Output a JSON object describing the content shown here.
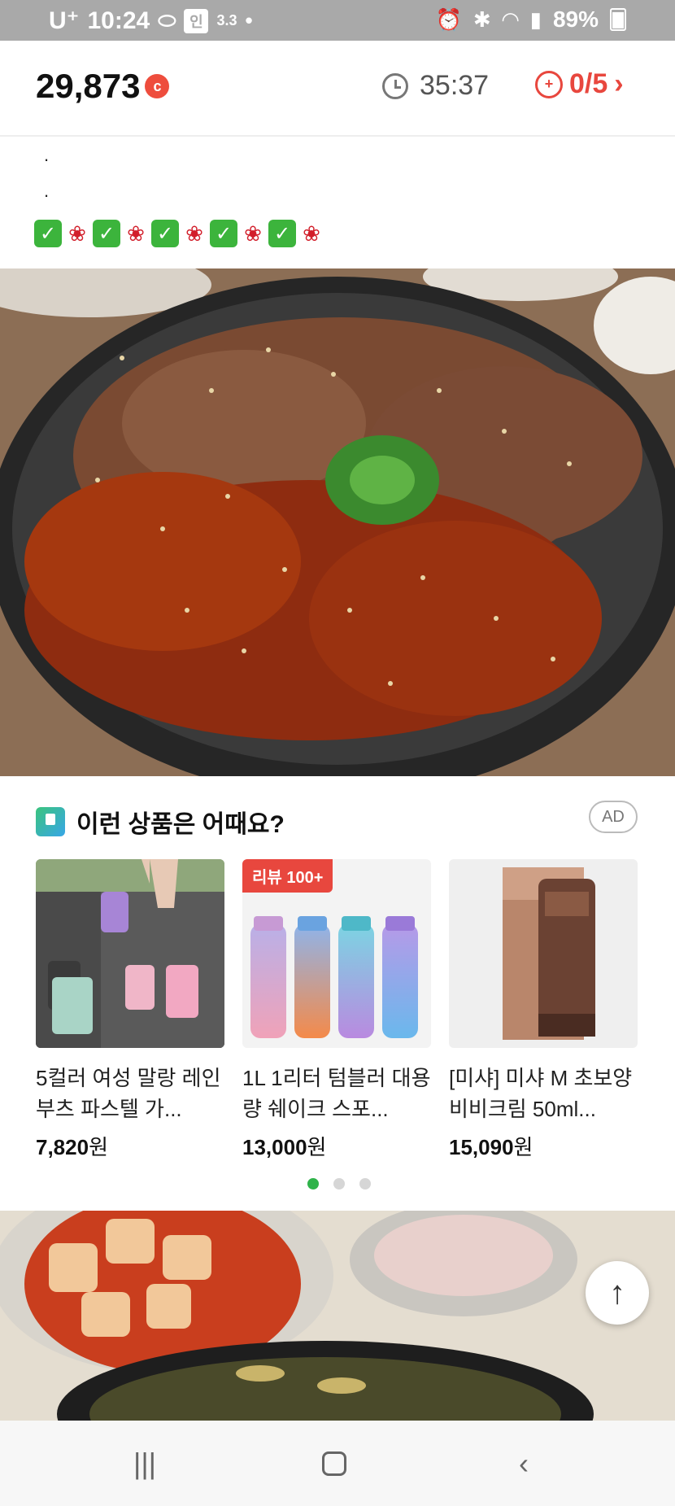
{
  "status_bar": {
    "carrier": "U⁺",
    "time": "10:24",
    "badge_text": "인",
    "small_text": "3.3",
    "battery": "89%",
    "icons": [
      "pill-icon",
      "alarm-icon",
      "bluetooth-icon",
      "wifi-icon",
      "signal-icon",
      "battery-icon"
    ]
  },
  "top_bar": {
    "points": "29,873",
    "coin_label": "c",
    "timer": "35:37",
    "progress": "0/5"
  },
  "post": {
    "dot1": ".",
    "dot2": "."
  },
  "ad_section": {
    "title": "이런 상품은 어때요?",
    "ad_label": "AD",
    "products": [
      {
        "name": "5컬러 여성 말랑 레인부츠 파스텔 가...",
        "price": "7,820",
        "unit": "원",
        "badge": ""
      },
      {
        "name": "1L 1리터 텀블러 대용량 쉐이크 스포...",
        "price": "13,000",
        "unit": "원",
        "badge": "리뷰 100+"
      },
      {
        "name": "[미샤] 미샤 M 초보양 비비크림 50ml...",
        "price": "15,090",
        "unit": "원",
        "badge": ""
      }
    ],
    "page_index": 1,
    "page_count": 3
  },
  "colors": {
    "accent": "#e8473e",
    "pager_active": "#2fb34a"
  }
}
